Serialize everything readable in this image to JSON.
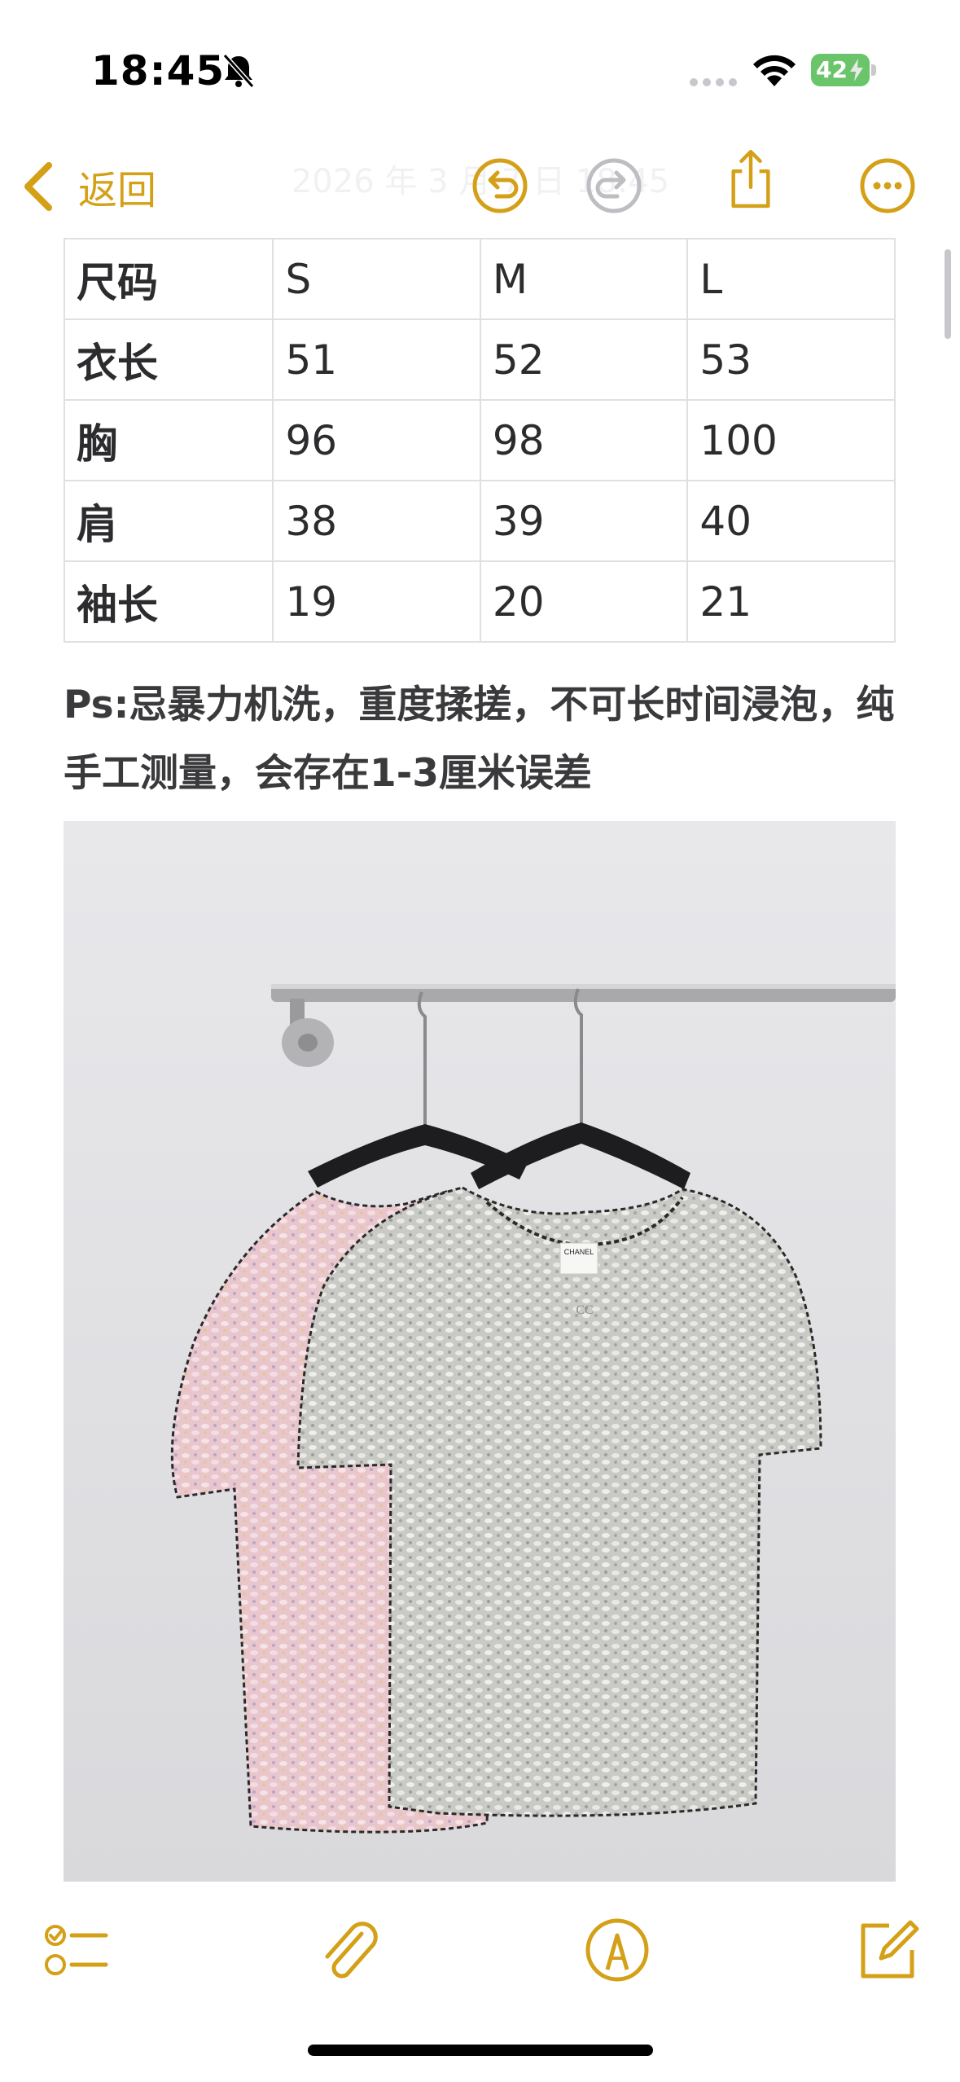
{
  "status_bar": {
    "time": "18:45",
    "battery_level": "42",
    "icons": [
      "bell-slash-icon",
      "signal-dots-icon",
      "wifi-icon",
      "battery-charging-icon"
    ]
  },
  "nav": {
    "back_label": "返回",
    "faded_title": "2026 年 3 月 7 日 18:45",
    "icons": [
      "chevron-left-icon",
      "undo-icon",
      "redo-icon",
      "share-icon",
      "more-icon"
    ]
  },
  "size_table": {
    "rows": [
      [
        "尺码",
        "S",
        "M",
        "L"
      ],
      [
        "衣长",
        "51",
        "52",
        "53"
      ],
      [
        "胸",
        "96",
        "98",
        "100"
      ],
      [
        "肩",
        "38",
        "39",
        "40"
      ],
      [
        "袖长",
        "19",
        "20",
        "21"
      ]
    ]
  },
  "note_text": "Ps:忌暴力机洗，重度揉搓，不可长时间浸泡，纯手工测量，会存在1-3厘米误差",
  "photo": {
    "subject": "two knit short-sleeve tops on hangers (pink and grey)",
    "label_text": "CHANEL"
  },
  "toolbar": {
    "icons": [
      "checklist-icon",
      "paperclip-icon",
      "markup-pen-icon",
      "compose-icon"
    ]
  },
  "colors": {
    "accent": "#d4a017",
    "disabled": "#bdbdc2",
    "table_border": "#e0e0e3",
    "text": "#2c2c2e"
  }
}
